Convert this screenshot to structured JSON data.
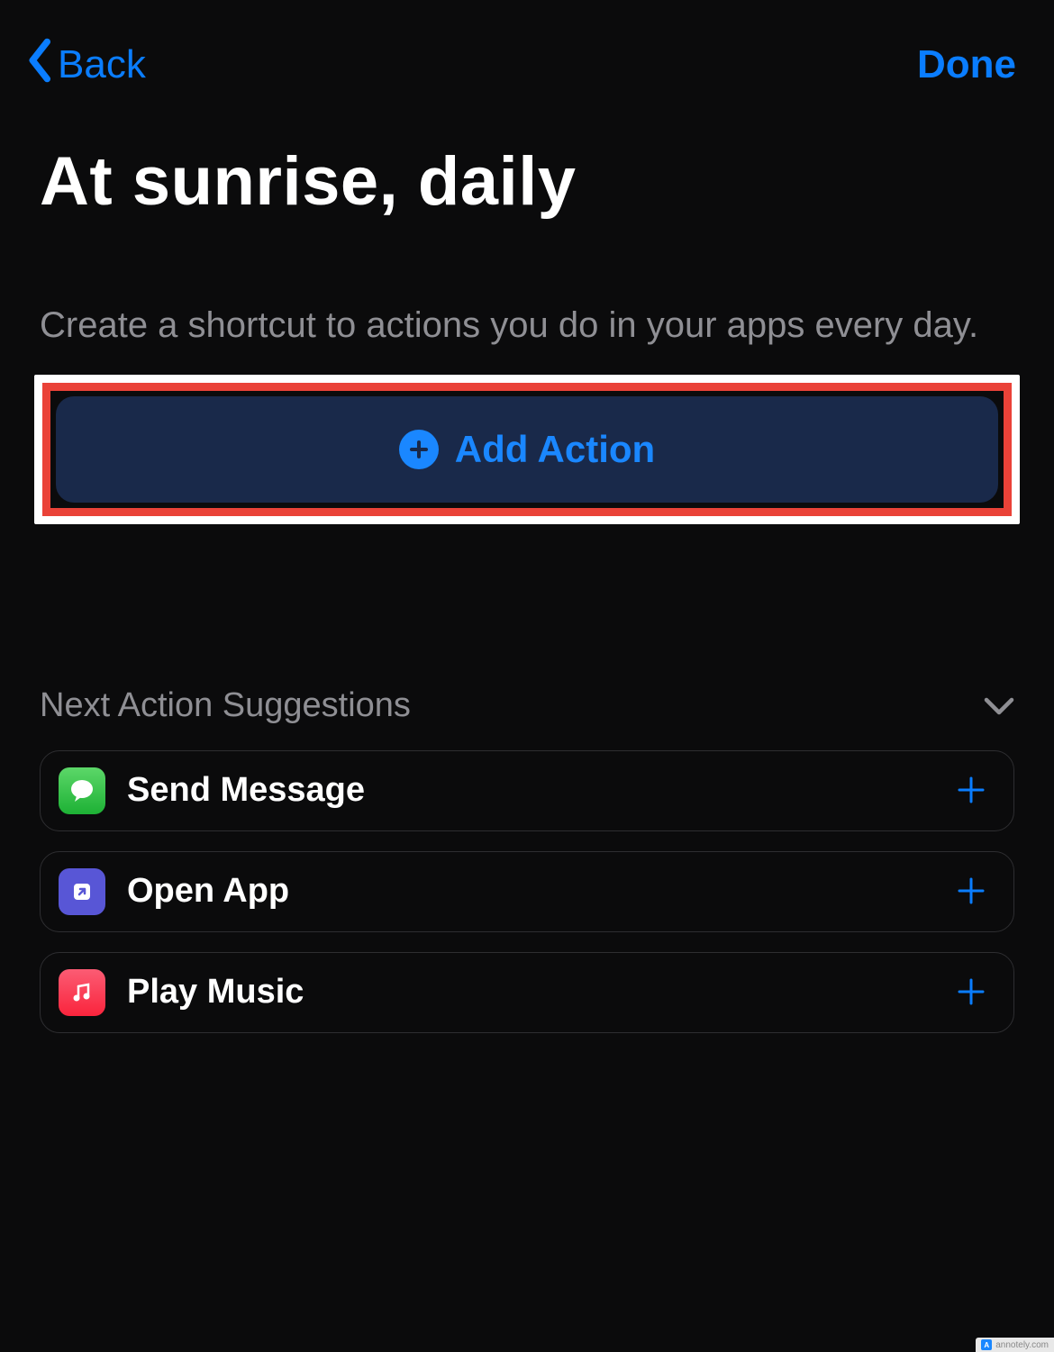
{
  "nav": {
    "back_label": "Back",
    "done_label": "Done"
  },
  "header": {
    "title": "At sunrise, daily",
    "description": "Create a shortcut to actions you do in your apps every day."
  },
  "actions": {
    "add_action_label": "Add Action"
  },
  "suggestions": {
    "header": "Next Action Suggestions",
    "items": [
      {
        "icon": "messages",
        "label": "Send Message"
      },
      {
        "icon": "open-app",
        "label": "Open App"
      },
      {
        "icon": "music",
        "label": "Play Music"
      }
    ]
  },
  "annotation": {
    "highlighted_element": "add-action-button",
    "outer_border_color": "#ffffff",
    "inner_border_color": "#ea4238"
  },
  "watermark": {
    "text": "annotely.com"
  }
}
